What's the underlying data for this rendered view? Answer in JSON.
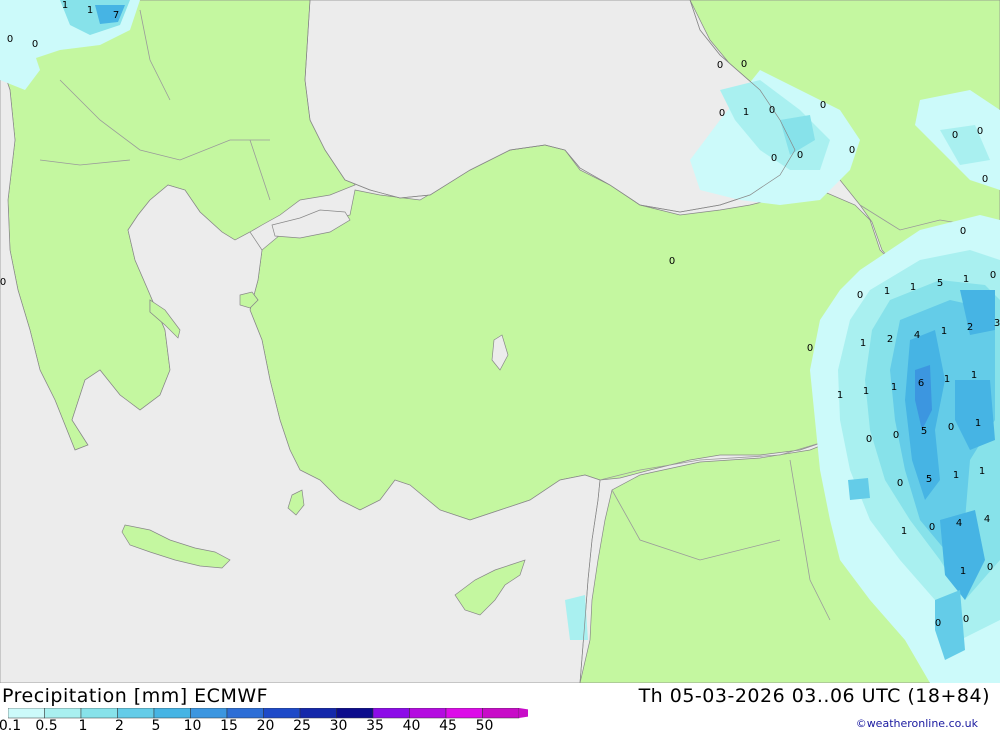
{
  "header": {
    "title": "Precipitation [mm] ECMWF",
    "datetime": "Th 05-03-2026 03..06 UTC (18+84)",
    "credit": "©weatheronline.co.uk"
  },
  "legend": {
    "ticks": [
      "0.1",
      "0.5",
      "1",
      "2",
      "5",
      "10",
      "15",
      "20",
      "25",
      "30",
      "35",
      "40",
      "45",
      "50"
    ],
    "colors": [
      "#ccfafa",
      "#a9f0f0",
      "#87e2ea",
      "#64cce8",
      "#46b4e4",
      "#3c96e0",
      "#2d6ed6",
      "#1e4ac8",
      "#1428aa",
      "#0c0c8c",
      "#8c0ce8",
      "#b40ce0",
      "#dc0ce8",
      "#c80cc8"
    ]
  },
  "map": {
    "colors": {
      "sea": "#ececec",
      "land": "#c4f7a0",
      "border": "#9a9a9a",
      "coast": "#888888"
    },
    "values": [
      "1",
      "1",
      "7",
      "0",
      "0",
      "0",
      "0",
      "0",
      "0",
      "1",
      "0",
      "0",
      "0",
      "0",
      "0",
      "0",
      "0",
      "0",
      "0",
      "0",
      "0",
      "1",
      "1",
      "5",
      "0",
      "1",
      "2",
      "4",
      "1",
      "2",
      "3",
      "0",
      "1",
      "1",
      "1",
      "6",
      "1",
      "1",
      "0",
      "0",
      "5",
      "0",
      "1",
      "5",
      "1",
      "1",
      "0",
      "1",
      "0",
      "4",
      "4",
      "1",
      "1",
      "0",
      "0",
      "0"
    ]
  }
}
